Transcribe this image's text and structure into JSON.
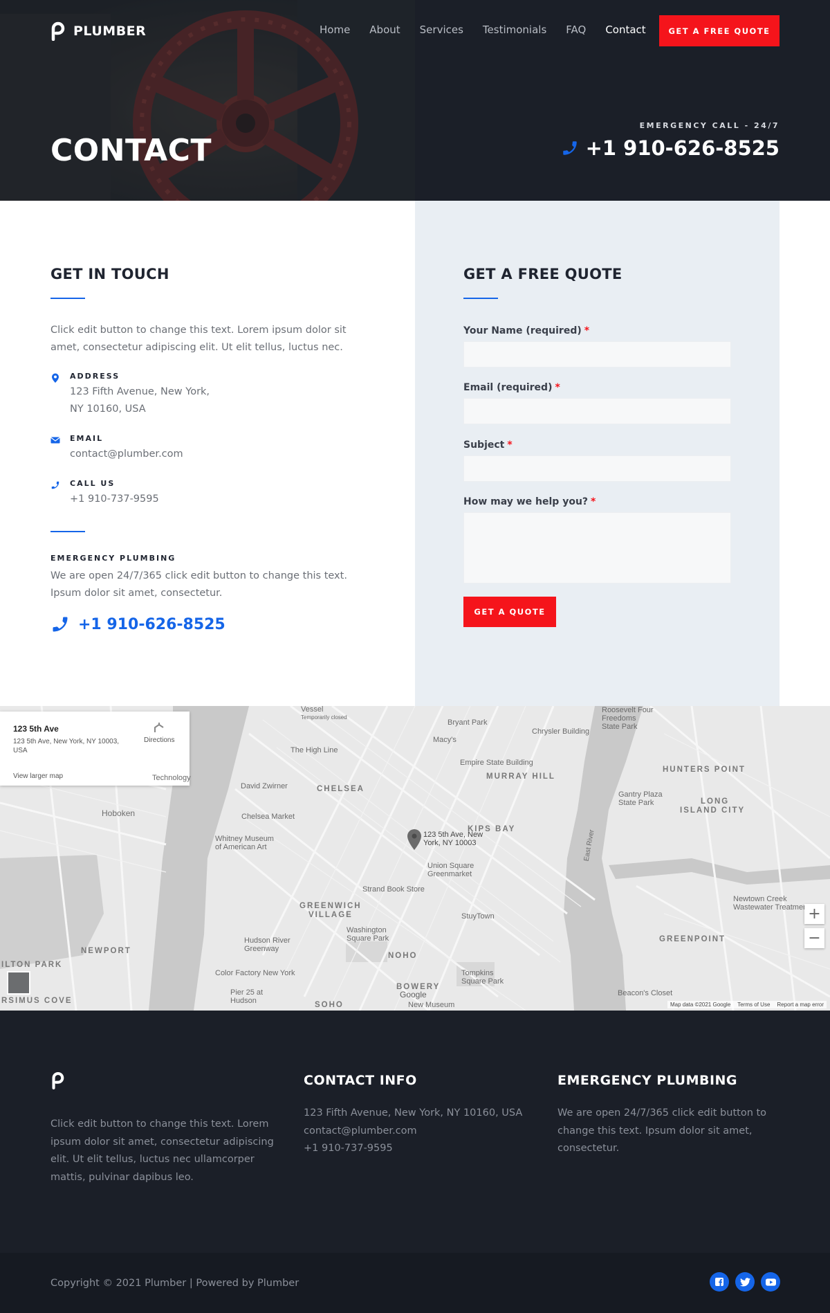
{
  "brand": {
    "name": "PLUMBER",
    "accent": "#f5141b",
    "blue": "#1565e8"
  },
  "nav": {
    "items": [
      "Home",
      "About",
      "Services",
      "Testimonials",
      "FAQ",
      "Contact"
    ],
    "active": "Contact"
  },
  "header": {
    "quote_button": "GET A FREE QUOTE"
  },
  "hero": {
    "title": "CONTACT",
    "emergency_label": "EMERGENCY CALL - 24/7",
    "emergency_phone": "+1 910-626-8525"
  },
  "get_in_touch": {
    "title": "GET IN TOUCH",
    "intro": "Click edit button to change this text. Lorem ipsum dolor sit amet, consectetur adipiscing elit. Ut elit tellus, luctus nec.",
    "address_label": "ADDRESS",
    "address_line1": "123 Fifth Avenue, New York,",
    "address_line2": "NY 10160, USA",
    "email_label": "EMAIL",
    "email_value": "contact@plumber.com",
    "call_label": "CALL US",
    "call_value": "+1 910-737-9595",
    "emergency_label": "EMERGENCY PLUMBING",
    "emergency_text": "We are open 24/7/365 click edit button to change this text. Ipsum dolor sit amet, consectetur.",
    "emergency_phone": "+1 910-626-8525"
  },
  "quote_form": {
    "title": "GET A FREE QUOTE",
    "name_label": "Your Name (required)",
    "email_label": "Email (required)",
    "subject_label": "Subject",
    "message_label": "How may we help you?",
    "required_mark": "*",
    "submit": "GET A QUOTE"
  },
  "map": {
    "card_title": "123 5th Ave",
    "card_address": "123 5th Ave, New York, NY 10003, USA",
    "card_link": "View larger map",
    "card_directions": "Directions",
    "pin_label_line1": "123 5th Ave, New",
    "pin_label_line2": "York, NY 10003",
    "labels": {
      "chelsea": "CHELSEA",
      "murray_hill": "MURRAY HILL",
      "kips_bay": "KIPS BAY",
      "greenwich": "GREENWICH",
      "village": "VILLAGE",
      "noho": "NOHO",
      "bowery": "BOWERY",
      "soho": "SOHO",
      "hunters_point": "HUNTERS POINT",
      "long": "LONG",
      "island_city": "ISLAND CITY",
      "greenpoint": "GREENPOINT",
      "newport": "NEWPORT",
      "hoboken": "Hoboken",
      "ilton_park": "ILTON PARK",
      "rsimus_cove": "RSIMUS COVE",
      "bryant_park": "Bryant Park",
      "macys": "Macy's",
      "chrysler": "Chrysler Building",
      "empire_state": "Empire State Building",
      "high_line": "The High Line",
      "david_zwirner": "David Zwirner",
      "chelsea_market": "Chelsea Market",
      "whitney_line1": "Whitney Museum",
      "whitney_line2": "of American Art",
      "union_square_line1": "Union Square",
      "union_square_line2": "Greenmarket",
      "strand": "Strand Book Store",
      "stuytown": "StuyTown",
      "washington_line1": "Washington",
      "washington_line2": "Square Park",
      "hudson_line1": "Hudson River",
      "hudson_line2": "Greenway",
      "color_factory": "Color Factory New York",
      "tompkins_line1": "Tompkins",
      "tompkins_line2": "Square Park",
      "new_museum": "New Museum",
      "pier_line1": "Pier 25 at",
      "pier_line2": "Hudson",
      "roosevelt_line1": "Roosevelt Four",
      "roosevelt_line2": "Freedoms",
      "roosevelt_line3": "State Park",
      "gantry_line1": "Gantry Plaza",
      "gantry_line2": "State Park",
      "newtown_line1": "Newtown Creek",
      "newtown_line2": "Wastewater Treatment...",
      "beacons": "Beacon's Closet",
      "vessel_line1": "Vessel",
      "vessel_line2": "Temporarily closed",
      "technology": "Technology",
      "east_river": "East River",
      "google": "Google"
    },
    "zoom_in": "+",
    "zoom_out": "−",
    "footer_data": "Map data ©2021 Google",
    "footer_terms": "Terms of Use",
    "footer_report": "Report a map error"
  },
  "footer": {
    "about_text": "Click edit button to change this text. Lorem ipsum dolor sit amet, consectetur adipiscing elit. Ut elit tellus, luctus nec ullamcorper mattis, pulvinar dapibus leo.",
    "contact_title": "CONTACT INFO",
    "contact_line1": "123 Fifth Avenue, New York, NY 10160, USA",
    "contact_line2": "contact@plumber.com",
    "contact_line3": "+1 910-737-9595",
    "emergency_title": "EMERGENCY PLUMBING",
    "emergency_text": "We are open 24/7/365 click edit button to change this text. Ipsum dolor sit amet, consectetur.",
    "copyright": "Copyright © 2021 Plumber | Powered by Plumber",
    "social": [
      "facebook-icon",
      "twitter-icon",
      "youtube-icon"
    ]
  }
}
